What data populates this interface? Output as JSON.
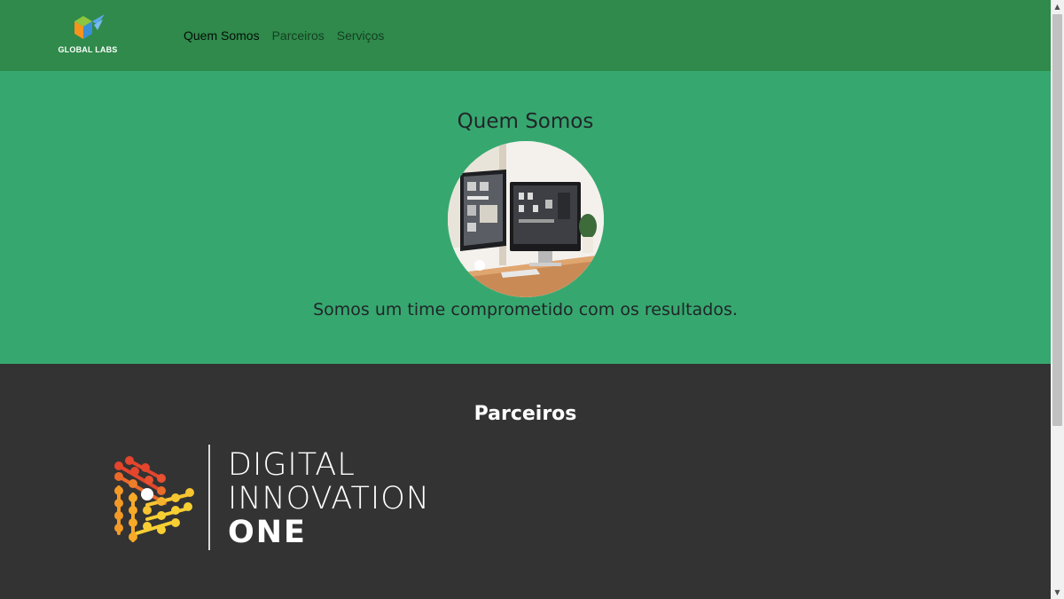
{
  "navbar": {
    "logo_text": "GLOBAL LABS",
    "links": [
      {
        "label": "Quem Somos",
        "active": true
      },
      {
        "label": "Parceiros",
        "active": false
      },
      {
        "label": "Serviços",
        "active": false
      }
    ]
  },
  "about": {
    "title": "Quem Somos",
    "text": "Somos um time comprometido com os resultados."
  },
  "partners": {
    "title": "Parceiros",
    "logo_lines": [
      "DIGITAL",
      "INNOVATION",
      "ONE"
    ]
  },
  "colors": {
    "navbar_bg": "#2f8a4b",
    "about_bg": "#36a86f",
    "partners_bg": "#333333"
  },
  "icons": {
    "brand": "global-labs-cube-logo",
    "partner": "digital-innovation-one-logo",
    "scroll_up": "triangle-up",
    "scroll_down": "triangle-down"
  }
}
